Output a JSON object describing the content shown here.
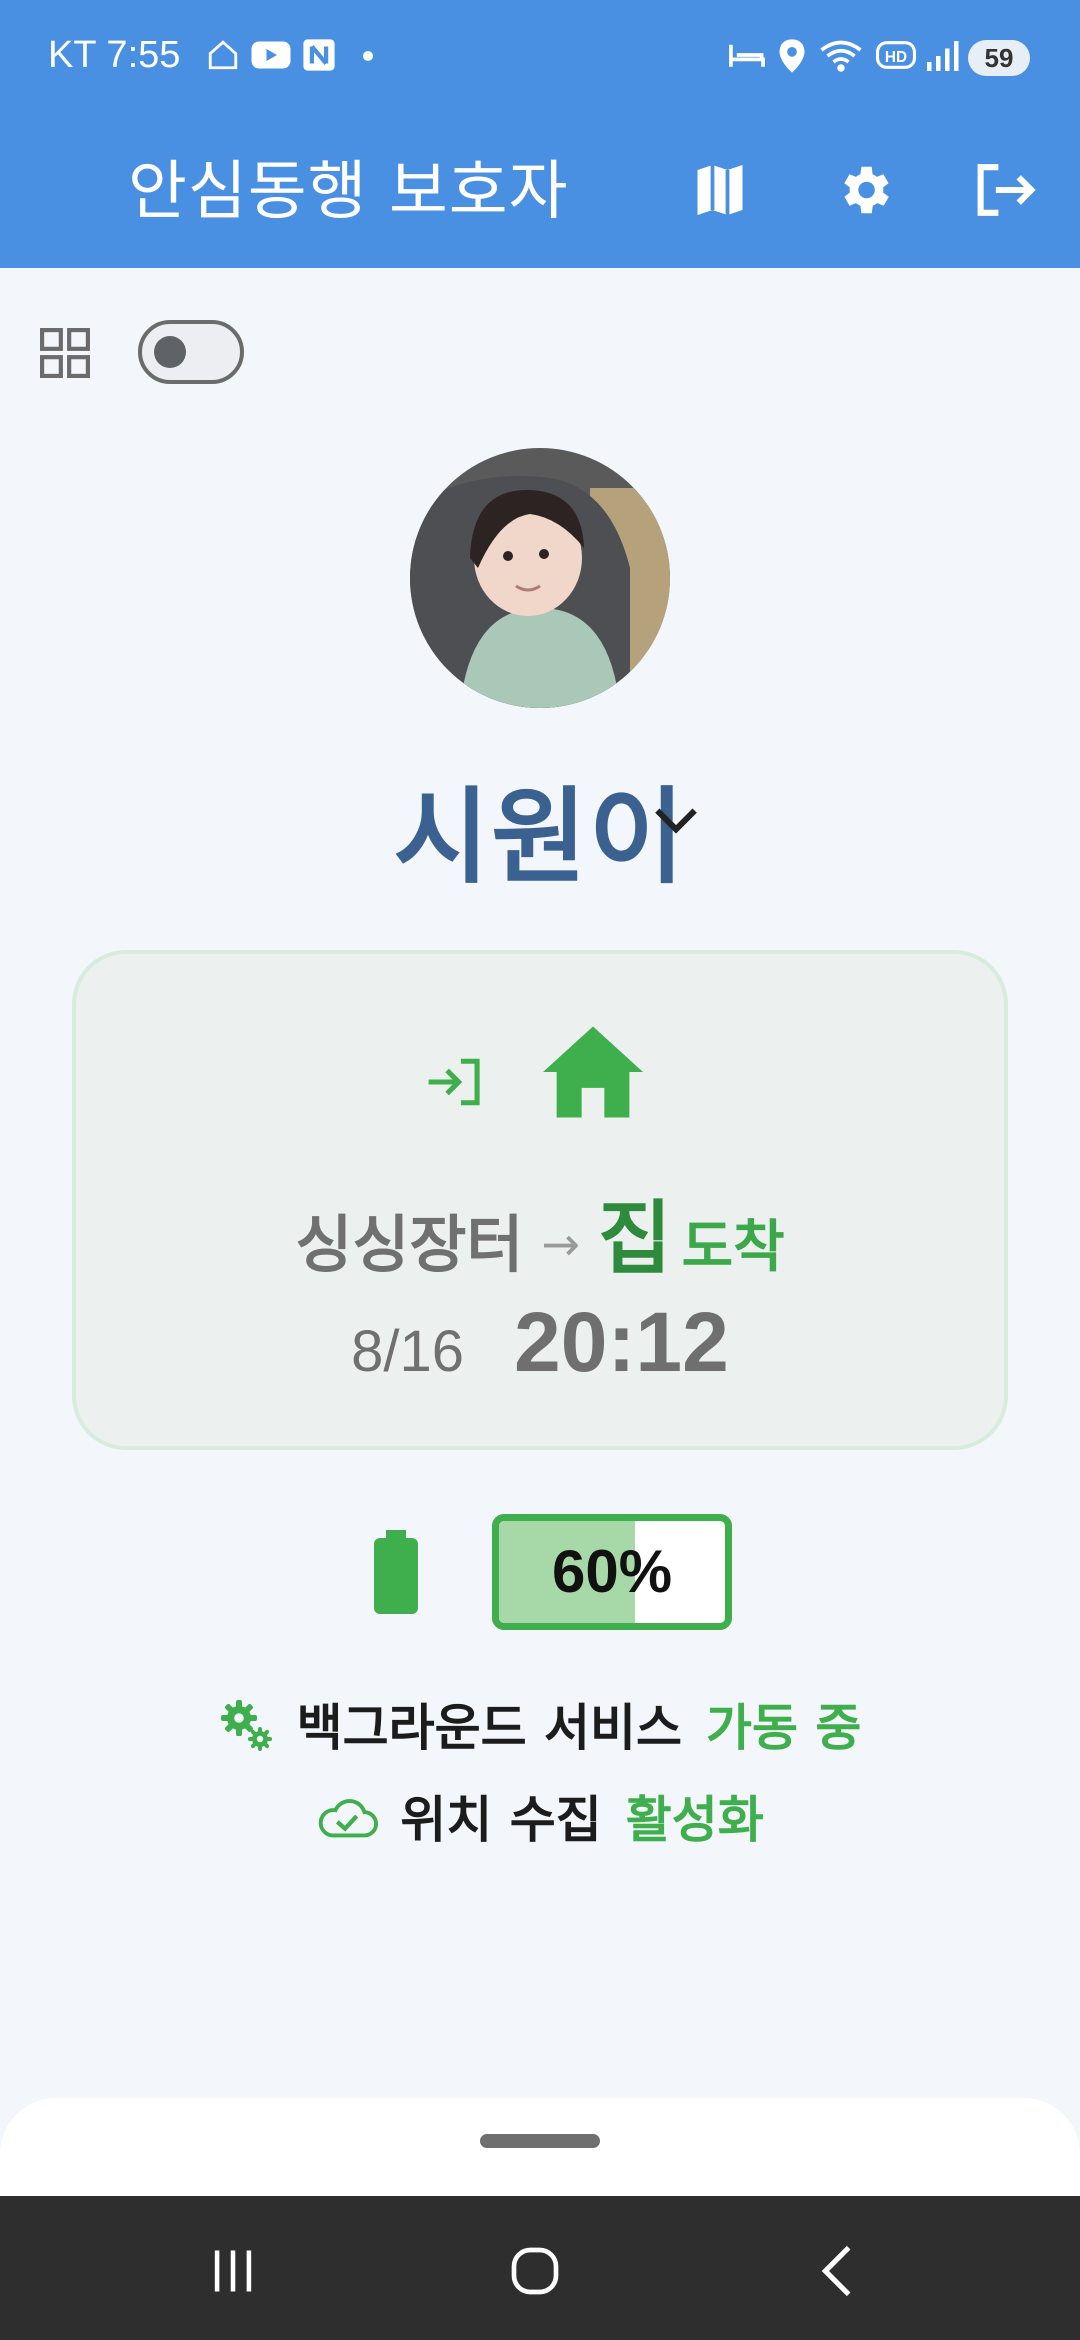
{
  "status_bar": {
    "carrier_time": "KT 7:55",
    "icons": [
      "home-outline-icon",
      "youtube-icon",
      "naver-icon",
      "dot-icon",
      "bed-icon",
      "location-icon",
      "wifi-icon",
      "hd-icon",
      "signal-icon"
    ],
    "battery_level": "59"
  },
  "app_bar": {
    "title": "안심동행 보호자",
    "actions": [
      "map-icon",
      "settings-gear-icon",
      "logout-icon"
    ],
    "color": "#4a90e2"
  },
  "controls": {
    "grid_icon": "grid-view-icon",
    "toggle_on": false
  },
  "child": {
    "name": "시원이",
    "selector_icon": "chevron-down-icon"
  },
  "location_card": {
    "event_icon": "enter-icon",
    "place_icon": "home-icon",
    "from": "싱싱장터",
    "arrow": "→",
    "to": "집",
    "status": "도착",
    "date": "8/16",
    "time": "20:12"
  },
  "battery": {
    "percent_label": "60%",
    "level": 0.6,
    "color": "#3fae4c"
  },
  "services": [
    {
      "icon": "gears-icon",
      "label": "백그라운드 서비스",
      "state": "가동 중"
    },
    {
      "icon": "cloud-check-icon",
      "label": "위치 수집",
      "state": "활성화"
    }
  ]
}
